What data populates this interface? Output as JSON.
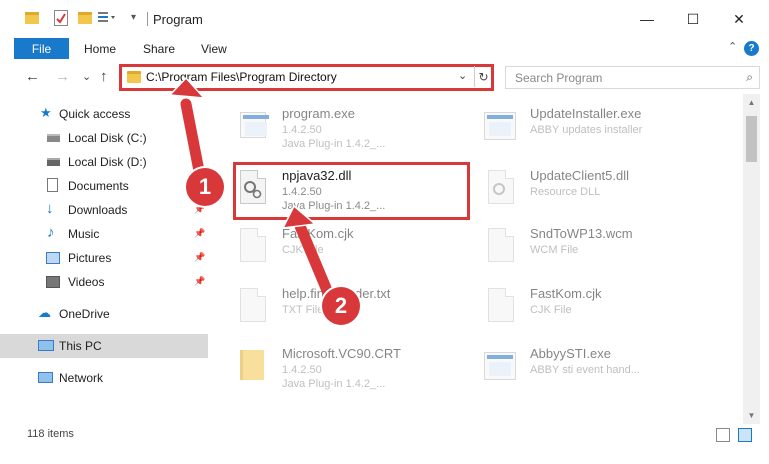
{
  "window": {
    "title": "Program",
    "minimize": "—",
    "maximize": "☐",
    "close": "✕",
    "collapse_chevron": "⌃"
  },
  "ribbon": {
    "file": "File",
    "tabs": [
      "Home",
      "Share",
      "View"
    ],
    "help": "?"
  },
  "address": {
    "path": "C:\\Program Files\\Program Directory",
    "chevron": "⌄",
    "refresh": "↻"
  },
  "nav_buttons": {
    "back": "←",
    "forward": "→",
    "recent": "⌄",
    "up": "↑"
  },
  "search": {
    "placeholder": "Search Program",
    "icon": "⌕"
  },
  "sidebar": {
    "items": [
      {
        "label": "Quick access",
        "icon": "star-icon",
        "pinned": false
      },
      {
        "label": "Local Disk (C:)",
        "icon": "drive-icon",
        "pinned": false
      },
      {
        "label": "Local Disk (D:)",
        "icon": "drive-icon",
        "pinned": false
      },
      {
        "label": "Documents",
        "icon": "documents-icon",
        "pinned": true
      },
      {
        "label": "Downloads",
        "icon": "download-icon",
        "pinned": true
      },
      {
        "label": "Music",
        "icon": "music-icon",
        "pinned": true
      },
      {
        "label": "Pictures",
        "icon": "pictures-icon",
        "pinned": true
      },
      {
        "label": "Videos",
        "icon": "videos-icon",
        "pinned": true
      },
      {
        "label": "OneDrive",
        "icon": "cloud-icon",
        "pinned": false
      },
      {
        "label": "This PC",
        "icon": "computer-icon",
        "pinned": false,
        "selected": true
      },
      {
        "label": "Network",
        "icon": "network-icon",
        "pinned": false
      }
    ]
  },
  "files": [
    {
      "name": "program.exe",
      "l2": "1.4.2.50",
      "l3": "Java Plug-in 1.4.2_...",
      "faded": true
    },
    {
      "name": "UpdateInstaller.exe",
      "l2": "ABBY updates installer",
      "l3": "",
      "faded": true
    },
    {
      "name": "npjava32.dll",
      "l2": "1.4.2.50",
      "l3": "Java Plug-in 1.4.2_...",
      "faded": false
    },
    {
      "name": "UpdateClient5.dll",
      "l2": "Resource DLL",
      "l3": "",
      "faded": true
    },
    {
      "name": "FastKom.cjk",
      "l2": "CJK File",
      "l3": "",
      "faded": true
    },
    {
      "name": "SndToWP13.wcm",
      "l2": "WCM File",
      "l3": "",
      "faded": true
    },
    {
      "name": "help.fineReader.txt",
      "l2": "TXT File",
      "l3": "",
      "faded": true
    },
    {
      "name": "FastKom.cjk",
      "l2": "CJK File",
      "l3": "",
      "faded": true
    },
    {
      "name": "Microsoft.VC90.CRT",
      "l2": "1.4.2.50",
      "l3": "Java Plug-in 1.4.2_...",
      "faded": true
    },
    {
      "name": "AbbyySTI.exe",
      "l2": "ABBY sti event hand...",
      "l3": "",
      "faded": true
    }
  ],
  "annotations": {
    "badge1": "1",
    "badge2": "2",
    "color": "#d8383a"
  },
  "status": {
    "items_count": "118 items"
  },
  "colors": {
    "accent": "#1979ca",
    "highlight": "#d8383a",
    "folder": "#f3c64c"
  }
}
